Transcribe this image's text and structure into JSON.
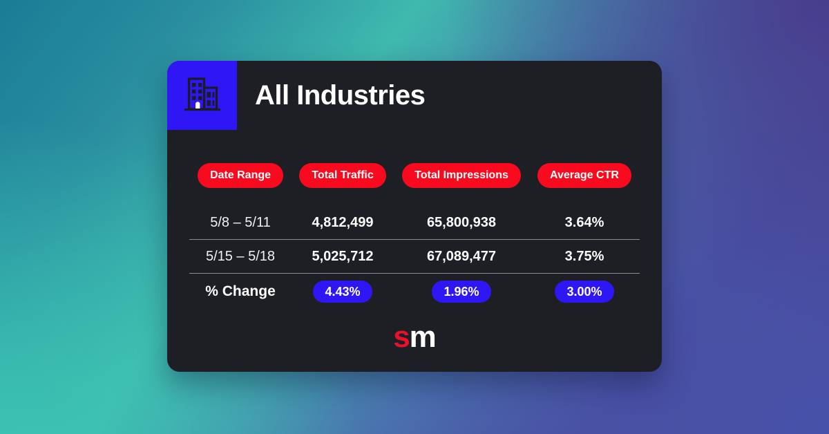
{
  "card": {
    "icon": "office-building-icon",
    "title": "All Industries",
    "accent_red": "#fa0a1e",
    "accent_blue": "#2f16f5",
    "background": "#1e1f24"
  },
  "table": {
    "headers": [
      "Date Range",
      "Total Traffic",
      "Total Impressions",
      "Average CTR"
    ],
    "rows": [
      {
        "date_range": "5/8 – 5/11",
        "total_traffic": "4,812,499",
        "total_impressions": "65,800,938",
        "average_ctr": "3.64%"
      },
      {
        "date_range": "5/15 – 5/18",
        "total_traffic": "5,025,712",
        "total_impressions": "67,089,477",
        "average_ctr": "3.75%"
      }
    ],
    "change": {
      "label": "% Change",
      "total_traffic": "4.43%",
      "total_impressions": "1.96%",
      "average_ctr": "3.00%"
    }
  },
  "logo": {
    "part1": "s",
    "part2": "m"
  },
  "background": {
    "gradient_start": "#1a7d96",
    "gradient_teal": "#3cc2b4",
    "gradient_purple": "#4a4486",
    "gradient_end": "#4a50a5"
  }
}
